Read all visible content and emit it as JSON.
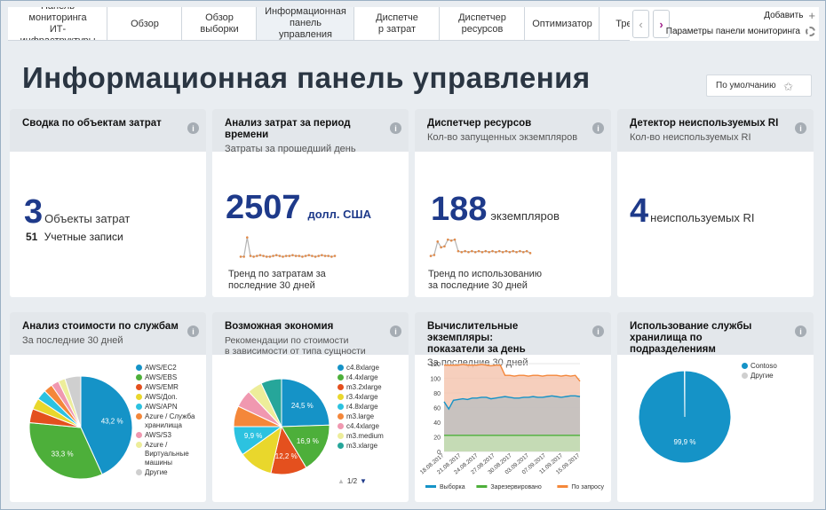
{
  "tabs": [
    {
      "label": "Панель мониторинга\nИТ-инфраструктуры",
      "active": false
    },
    {
      "label": "Обзор",
      "active": false
    },
    {
      "label": "Обзор\nвыборки",
      "active": false
    },
    {
      "label": "Информационная\nпанель управления",
      "active": true
    },
    {
      "label": "Диспетче\nр затрат",
      "active": false
    },
    {
      "label": "Диспетчер\nресурсов",
      "active": false
    },
    {
      "label": "Оптимизатор",
      "active": false
    },
    {
      "label": "Трекеры",
      "active": false
    }
  ],
  "top_right": {
    "add_label": "Добавить",
    "settings_label": "Параметры панели мониторинга"
  },
  "page_title": "Информационная панель управления",
  "default_button": "По умолчанию",
  "cards": {
    "cost_objects": {
      "title": "Сводка по объектам затрат",
      "big_value": "3",
      "big_unit": "Объекты затрат",
      "small_value": "51",
      "small_unit": "Учетные записи"
    },
    "cost_analysis": {
      "title": "Анализ затрат за период времени",
      "subtitle": "Затраты за прошедший день",
      "big_value": "2507",
      "big_unit": "долл. США",
      "trend": "Тренд по затратам за\nпоследние 30 дней"
    },
    "resource_manager": {
      "title": "Диспетчер ресурсов",
      "subtitle": "Кол-во запущенных экземпляров",
      "big_value": "188",
      "big_unit": "экземпляров",
      "trend": "Тренд по использованию\nза последние 30 дней"
    },
    "ri_detector": {
      "title": "Детектор неиспользуемых RI",
      "subtitle": "Кол-во неиспользуемых RI",
      "big_value": "4",
      "big_unit": "неиспользуемых RI"
    },
    "service_cost": {
      "title": "Анализ стоимости по службам",
      "subtitle": "За последние 30 дней"
    },
    "savings": {
      "title": "Возможная экономия",
      "subtitle": "Рекомендации по стоимости\nв зависимости от типа сущности",
      "pager": "1/2"
    },
    "compute": {
      "title": "Вычислительные экземпляры:\nпоказатели за день",
      "subtitle": "За последние 30 дней"
    },
    "storage": {
      "title": "Использование службы\nхранилища по подразделениям"
    }
  },
  "chart_data": [
    {
      "type": "pie",
      "title": "Анализ стоимости по службам",
      "categories": [
        "AWS/EC2",
        "AWS/EBS",
        "AWS/EMR",
        "AWS/Доп.",
        "AWS/APN",
        "Azure / Служба хранилища",
        "AWS/S3",
        "Azure / Виртуальные машины",
        "Другие"
      ],
      "values": [
        43.2,
        33.3,
        4.4,
        3.5,
        3.2,
        2.8,
        2.4,
        2.2,
        5.0
      ],
      "colors": [
        "#1593c7",
        "#4daf3a",
        "#e4501e",
        "#e9d72c",
        "#2cc2e0",
        "#f4873a",
        "#f098b0",
        "#eded9a",
        "#cfcfcf"
      ],
      "data_labels": [
        "43,2 %",
        "33,3 %"
      ]
    },
    {
      "type": "pie",
      "title": "Возможная экономия",
      "categories": [
        "c4.8xlarge",
        "r4.4xlarge",
        "m3.2xlarge",
        "r3.4xlarge",
        "r4.8xlarge",
        "m3.large",
        "c4.4xlarge",
        "m3.medium",
        "m3.xlarge"
      ],
      "values": [
        24.5,
        16.9,
        12.2,
        11.5,
        9.9,
        7.0,
        6.0,
        5.0,
        7.0
      ],
      "colors": [
        "#1593c7",
        "#4daf3a",
        "#e4501e",
        "#e9d72c",
        "#2cc2e0",
        "#f4873a",
        "#f098b0",
        "#eded9a",
        "#26a69a"
      ],
      "data_labels": [
        "24,5 %",
        "16,9 %",
        "12,2 %",
        "",
        "9,9 %",
        "",
        "",
        "",
        ""
      ]
    },
    {
      "type": "area",
      "title": "Вычислительные экземпляры: показатели за день",
      "x": [
        "18.08.2017",
        "21.08.2017",
        "24.08.2017",
        "27.08.2017",
        "30.08.2017",
        "03.09.2017",
        "07.09.2017",
        "11.09.2017",
        "15.09.2017"
      ],
      "ylim": [
        0,
        120
      ],
      "yticks": [
        0,
        20,
        40,
        60,
        80,
        100,
        120
      ],
      "series": [
        {
          "name": "Выборка",
          "color": "#1593c7",
          "values": [
            68,
            58,
            70,
            71,
            72,
            71,
            73,
            73,
            74,
            74,
            72,
            73,
            74,
            75,
            74,
            73,
            73,
            74,
            74,
            75,
            74,
            74,
            75,
            76,
            75,
            74,
            75,
            76,
            76,
            75
          ]
        },
        {
          "name": "Зарезервировано",
          "color": "#4daf3a",
          "values": [
            22,
            22,
            22,
            22,
            22,
            22,
            22,
            22,
            22,
            22,
            22,
            22,
            22,
            22,
            22,
            22,
            22,
            22,
            22,
            22,
            22,
            22,
            22,
            22,
            22,
            22,
            22,
            22,
            22,
            22
          ]
        },
        {
          "name": "По запросу",
          "color": "#f4873a",
          "values": [
            118,
            118,
            118,
            118,
            119,
            118,
            118,
            118,
            119,
            118,
            117,
            118,
            118,
            104,
            104,
            103,
            104,
            104,
            103,
            104,
            104,
            103,
            104,
            104,
            104,
            103,
            104,
            103,
            104,
            96
          ]
        }
      ]
    },
    {
      "type": "pie",
      "title": "Использование службы хранилища по подразделениям",
      "categories": [
        "Contoso",
        "Другие"
      ],
      "values": [
        99.9,
        0.1
      ],
      "colors": [
        "#1593c7",
        "#cfcfcf"
      ],
      "data_labels": [
        "99,9 %",
        ""
      ]
    },
    {
      "type": "line",
      "title": "Тренд по затратам",
      "values": [
        3,
        3,
        28,
        4,
        3,
        4,
        5,
        4,
        3,
        3,
        4,
        5,
        4,
        3,
        4,
        4,
        5,
        4,
        4,
        3,
        4,
        5,
        4,
        3,
        4,
        5,
        4,
        4,
        3,
        4
      ]
    },
    {
      "type": "line",
      "title": "Тренд по использованию",
      "values": [
        5,
        6,
        20,
        14,
        15,
        22,
        21,
        22,
        10,
        9,
        10,
        9,
        10,
        9,
        10,
        9,
        10,
        9,
        10,
        9,
        10,
        9,
        10,
        9,
        10,
        9,
        10,
        9,
        10,
        8
      ]
    }
  ]
}
